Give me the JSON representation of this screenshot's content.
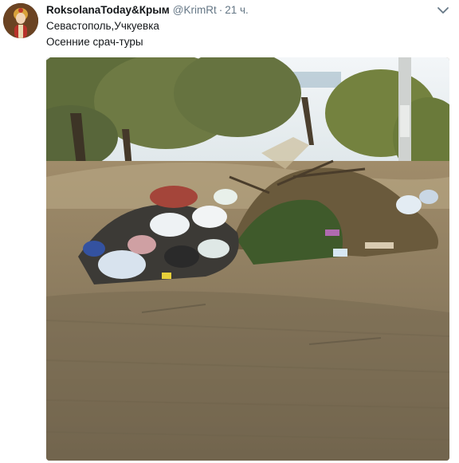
{
  "tweet": {
    "display_name": "RoksolanaToday&Крым",
    "handle": "@KrimRt",
    "separator": "·",
    "time": "21 ч.",
    "text_line_1": "Севастополь,Учкуевка",
    "text_line_2": "Осенние срач-туры"
  },
  "icons": {
    "caret": "chevron-down-icon"
  },
  "colors": {
    "name": "#14171a",
    "secondary": "#657786"
  }
}
